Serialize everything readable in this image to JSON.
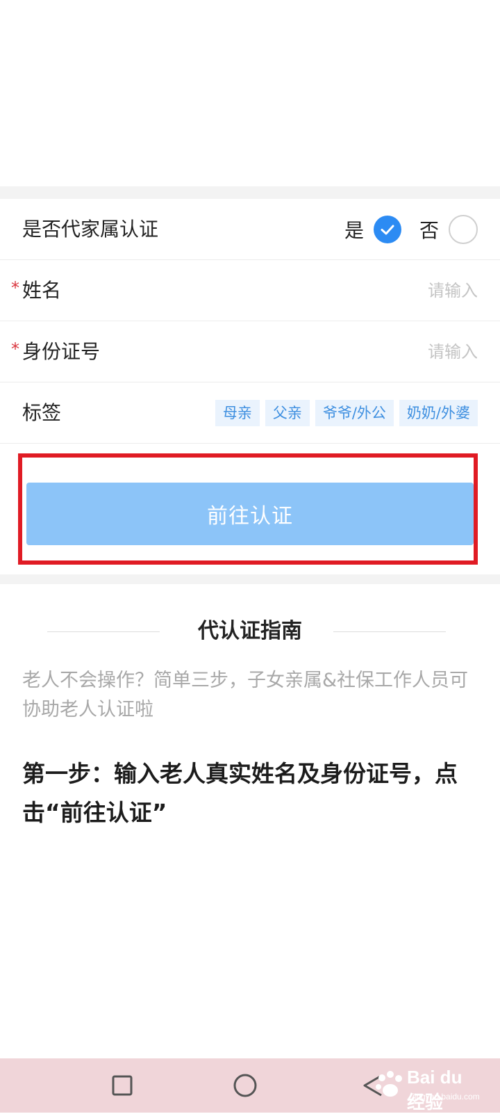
{
  "form": {
    "proxy_question": "是否代家属认证",
    "yes_label": "是",
    "no_label": "否",
    "required_mark": "*",
    "name_label": "姓名",
    "name_placeholder": "请输入",
    "id_label": "身份证号",
    "id_placeholder": "请输入",
    "tag_label": "标签",
    "tags": [
      "母亲",
      "父亲",
      "爷爷/外公",
      "奶奶/外婆"
    ],
    "submit_label": "前往认证"
  },
  "guide": {
    "title": "代认证指南",
    "description": "老人不会操作？简单三步，子女亲属&社保工作人员可协助老人认证啦",
    "step1": "第一步：输入老人真实姓名及身份证号，点击“前往认证”"
  },
  "watermark": {
    "brand": "Bai du 经验",
    "url": "jingyan.baidu.com"
  },
  "colors": {
    "accent": "#2c8bf3",
    "button": "#8cc4f8",
    "highlight": "#e01b24",
    "tag_bg": "#eaf3fd",
    "tag_text": "#3e8fe0"
  },
  "nav_icons": [
    "square-icon",
    "circle-icon",
    "back-triangle-icon"
  ]
}
